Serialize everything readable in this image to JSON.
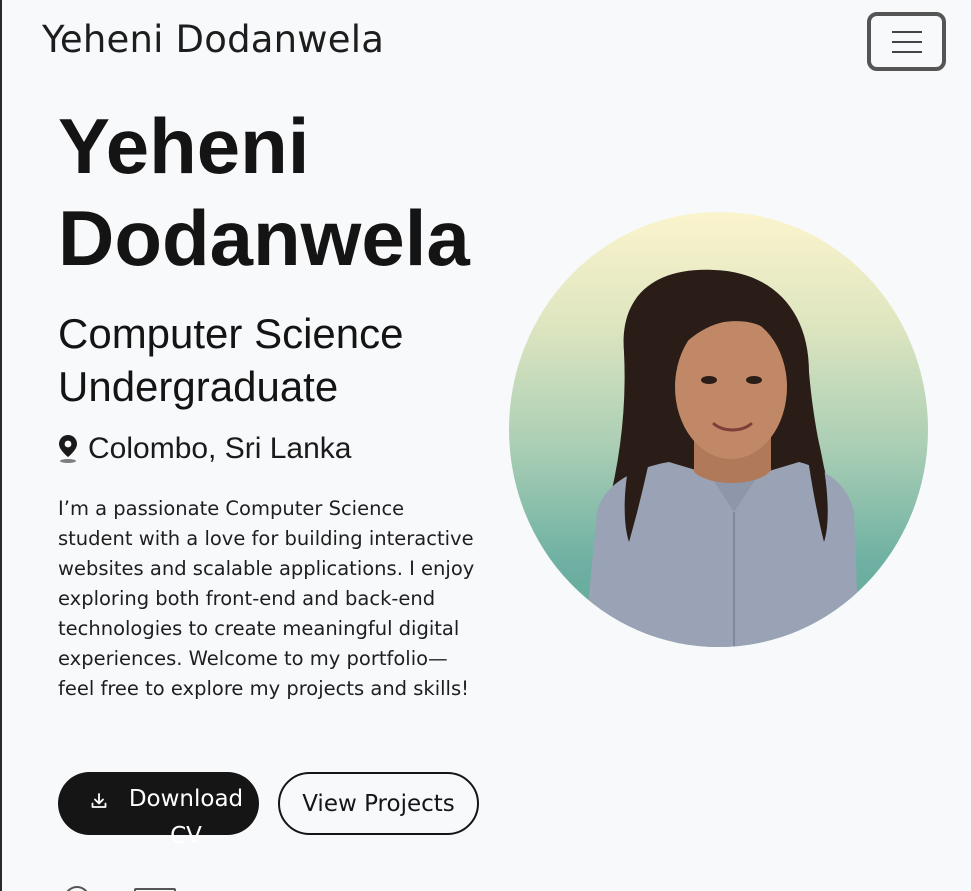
{
  "navbar": {
    "brand": "Yeheni Dodanwela",
    "menu_icon": "hamburger-menu-icon"
  },
  "hero": {
    "name": "Yeheni Dodanwela",
    "role": "Computer Science Undergraduate",
    "location": "Colombo, Sri Lanka",
    "location_icon": "map-pin-icon",
    "bio": "I’m a passionate Computer Science student with a love for building interactive websites and scalable applications. I enjoy exploring both front-end and back-end technologies to create meaningful digital experiences. Welcome to my portfolio—feel free to explore my projects and skills!",
    "buttons": {
      "download_cv": "Download CV",
      "download_icon": "download-icon",
      "view_projects": "View Projects"
    }
  },
  "colors": {
    "text": "#141414",
    "button_dark": "#151515",
    "background": "#f8f9fb",
    "portrait_top": "#fbf4cd",
    "portrait_bottom": "#5ea699"
  }
}
